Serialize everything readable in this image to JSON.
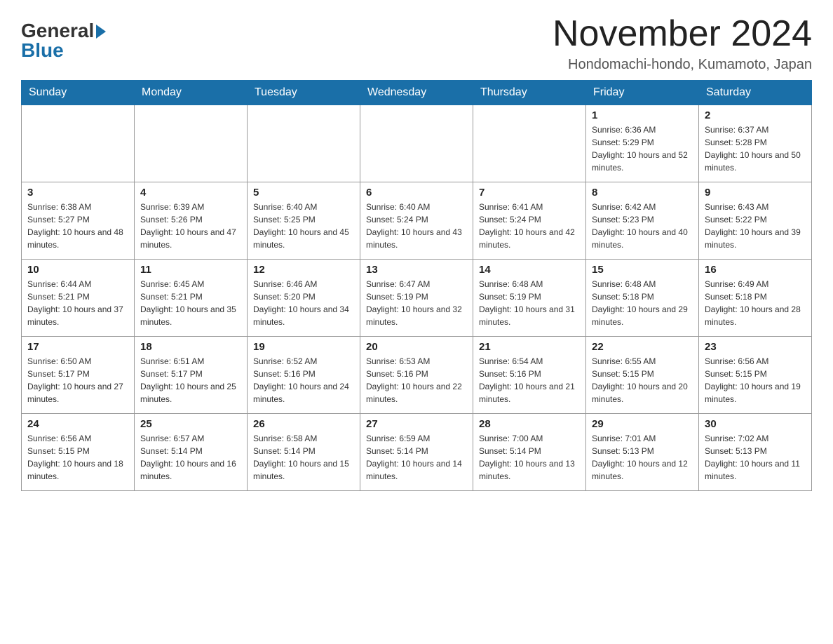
{
  "header": {
    "logo_general": "General",
    "logo_blue": "Blue",
    "month_title": "November 2024",
    "location": "Hondomachi-hondo, Kumamoto, Japan"
  },
  "weekdays": [
    "Sunday",
    "Monday",
    "Tuesday",
    "Wednesday",
    "Thursday",
    "Friday",
    "Saturday"
  ],
  "weeks": [
    [
      {
        "day": "",
        "info": ""
      },
      {
        "day": "",
        "info": ""
      },
      {
        "day": "",
        "info": ""
      },
      {
        "day": "",
        "info": ""
      },
      {
        "day": "",
        "info": ""
      },
      {
        "day": "1",
        "info": "Sunrise: 6:36 AM\nSunset: 5:29 PM\nDaylight: 10 hours and 52 minutes."
      },
      {
        "day": "2",
        "info": "Sunrise: 6:37 AM\nSunset: 5:28 PM\nDaylight: 10 hours and 50 minutes."
      }
    ],
    [
      {
        "day": "3",
        "info": "Sunrise: 6:38 AM\nSunset: 5:27 PM\nDaylight: 10 hours and 48 minutes."
      },
      {
        "day": "4",
        "info": "Sunrise: 6:39 AM\nSunset: 5:26 PM\nDaylight: 10 hours and 47 minutes."
      },
      {
        "day": "5",
        "info": "Sunrise: 6:40 AM\nSunset: 5:25 PM\nDaylight: 10 hours and 45 minutes."
      },
      {
        "day": "6",
        "info": "Sunrise: 6:40 AM\nSunset: 5:24 PM\nDaylight: 10 hours and 43 minutes."
      },
      {
        "day": "7",
        "info": "Sunrise: 6:41 AM\nSunset: 5:24 PM\nDaylight: 10 hours and 42 minutes."
      },
      {
        "day": "8",
        "info": "Sunrise: 6:42 AM\nSunset: 5:23 PM\nDaylight: 10 hours and 40 minutes."
      },
      {
        "day": "9",
        "info": "Sunrise: 6:43 AM\nSunset: 5:22 PM\nDaylight: 10 hours and 39 minutes."
      }
    ],
    [
      {
        "day": "10",
        "info": "Sunrise: 6:44 AM\nSunset: 5:21 PM\nDaylight: 10 hours and 37 minutes."
      },
      {
        "day": "11",
        "info": "Sunrise: 6:45 AM\nSunset: 5:21 PM\nDaylight: 10 hours and 35 minutes."
      },
      {
        "day": "12",
        "info": "Sunrise: 6:46 AM\nSunset: 5:20 PM\nDaylight: 10 hours and 34 minutes."
      },
      {
        "day": "13",
        "info": "Sunrise: 6:47 AM\nSunset: 5:19 PM\nDaylight: 10 hours and 32 minutes."
      },
      {
        "day": "14",
        "info": "Sunrise: 6:48 AM\nSunset: 5:19 PM\nDaylight: 10 hours and 31 minutes."
      },
      {
        "day": "15",
        "info": "Sunrise: 6:48 AM\nSunset: 5:18 PM\nDaylight: 10 hours and 29 minutes."
      },
      {
        "day": "16",
        "info": "Sunrise: 6:49 AM\nSunset: 5:18 PM\nDaylight: 10 hours and 28 minutes."
      }
    ],
    [
      {
        "day": "17",
        "info": "Sunrise: 6:50 AM\nSunset: 5:17 PM\nDaylight: 10 hours and 27 minutes."
      },
      {
        "day": "18",
        "info": "Sunrise: 6:51 AM\nSunset: 5:17 PM\nDaylight: 10 hours and 25 minutes."
      },
      {
        "day": "19",
        "info": "Sunrise: 6:52 AM\nSunset: 5:16 PM\nDaylight: 10 hours and 24 minutes."
      },
      {
        "day": "20",
        "info": "Sunrise: 6:53 AM\nSunset: 5:16 PM\nDaylight: 10 hours and 22 minutes."
      },
      {
        "day": "21",
        "info": "Sunrise: 6:54 AM\nSunset: 5:16 PM\nDaylight: 10 hours and 21 minutes."
      },
      {
        "day": "22",
        "info": "Sunrise: 6:55 AM\nSunset: 5:15 PM\nDaylight: 10 hours and 20 minutes."
      },
      {
        "day": "23",
        "info": "Sunrise: 6:56 AM\nSunset: 5:15 PM\nDaylight: 10 hours and 19 minutes."
      }
    ],
    [
      {
        "day": "24",
        "info": "Sunrise: 6:56 AM\nSunset: 5:15 PM\nDaylight: 10 hours and 18 minutes."
      },
      {
        "day": "25",
        "info": "Sunrise: 6:57 AM\nSunset: 5:14 PM\nDaylight: 10 hours and 16 minutes."
      },
      {
        "day": "26",
        "info": "Sunrise: 6:58 AM\nSunset: 5:14 PM\nDaylight: 10 hours and 15 minutes."
      },
      {
        "day": "27",
        "info": "Sunrise: 6:59 AM\nSunset: 5:14 PM\nDaylight: 10 hours and 14 minutes."
      },
      {
        "day": "28",
        "info": "Sunrise: 7:00 AM\nSunset: 5:14 PM\nDaylight: 10 hours and 13 minutes."
      },
      {
        "day": "29",
        "info": "Sunrise: 7:01 AM\nSunset: 5:13 PM\nDaylight: 10 hours and 12 minutes."
      },
      {
        "day": "30",
        "info": "Sunrise: 7:02 AM\nSunset: 5:13 PM\nDaylight: 10 hours and 11 minutes."
      }
    ]
  ]
}
